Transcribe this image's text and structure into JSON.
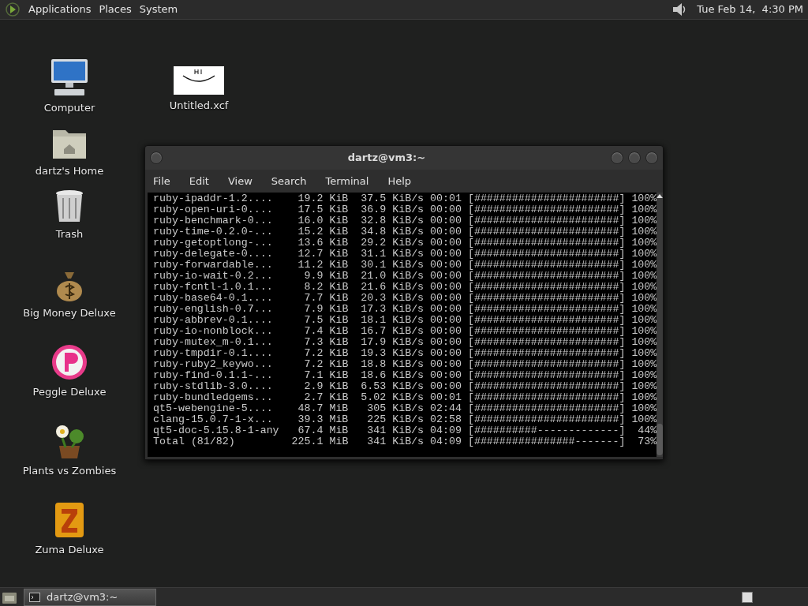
{
  "top_panel": {
    "menus": [
      "Applications",
      "Places",
      "System"
    ],
    "clock": "Tue Feb 14,  4:30 PM"
  },
  "desktop_icons": [
    {
      "label": "Computer",
      "kind": "computer"
    },
    {
      "label": "dartz's Home",
      "kind": "folder"
    },
    {
      "label": "Trash",
      "kind": "trash"
    },
    {
      "label": "Big Money Deluxe",
      "kind": "moneybag"
    },
    {
      "label": "Peggle Deluxe",
      "kind": "peggle"
    },
    {
      "label": "Plants vs Zombies",
      "kind": "plant"
    },
    {
      "label": "Zuma Deluxe",
      "kind": "zuma"
    },
    {
      "label": "Untitled.xcf",
      "kind": "image"
    }
  ],
  "terminal": {
    "title": "dartz@vm3:~",
    "menus": [
      "File",
      "Edit",
      "View",
      "Search",
      "Terminal",
      "Help"
    ],
    "rows": [
      {
        "name": "ruby-ipaddr-1.2....",
        "size": "19.2 KiB",
        "speed": "37.5 KiB/s",
        "time": "00:01",
        "bar": "[#######################]",
        "percent": "100%"
      },
      {
        "name": "ruby-open-uri-0....",
        "size": "17.5 KiB",
        "speed": "36.9 KiB/s",
        "time": "00:00",
        "bar": "[#######################]",
        "percent": "100%"
      },
      {
        "name": "ruby-benchmark-0...",
        "size": "16.0 KiB",
        "speed": "32.8 KiB/s",
        "time": "00:00",
        "bar": "[#######################]",
        "percent": "100%"
      },
      {
        "name": "ruby-time-0.2.0-...",
        "size": "15.2 KiB",
        "speed": "34.8 KiB/s",
        "time": "00:00",
        "bar": "[#######################]",
        "percent": "100%"
      },
      {
        "name": "ruby-getoptlong-...",
        "size": "13.6 KiB",
        "speed": "29.2 KiB/s",
        "time": "00:00",
        "bar": "[#######################]",
        "percent": "100%"
      },
      {
        "name": "ruby-delegate-0....",
        "size": "12.7 KiB",
        "speed": "31.1 KiB/s",
        "time": "00:00",
        "bar": "[#######################]",
        "percent": "100%"
      },
      {
        "name": "ruby-forwardable...",
        "size": "11.2 KiB",
        "speed": "30.1 KiB/s",
        "time": "00:00",
        "bar": "[#######################]",
        "percent": "100%"
      },
      {
        "name": "ruby-io-wait-0.2...",
        "size": "9.9 KiB",
        "speed": "21.0 KiB/s",
        "time": "00:00",
        "bar": "[#######################]",
        "percent": "100%"
      },
      {
        "name": "ruby-fcntl-1.0.1...",
        "size": "8.2 KiB",
        "speed": "21.6 KiB/s",
        "time": "00:00",
        "bar": "[#######################]",
        "percent": "100%"
      },
      {
        "name": "ruby-base64-0.1....",
        "size": "7.7 KiB",
        "speed": "20.3 KiB/s",
        "time": "00:00",
        "bar": "[#######################]",
        "percent": "100%"
      },
      {
        "name": "ruby-english-0.7...",
        "size": "7.9 KiB",
        "speed": "17.3 KiB/s",
        "time": "00:00",
        "bar": "[#######################]",
        "percent": "100%"
      },
      {
        "name": "ruby-abbrev-0.1....",
        "size": "7.5 KiB",
        "speed": "18.1 KiB/s",
        "time": "00:00",
        "bar": "[#######################]",
        "percent": "100%"
      },
      {
        "name": "ruby-io-nonblock...",
        "size": "7.4 KiB",
        "speed": "16.7 KiB/s",
        "time": "00:00",
        "bar": "[#######################]",
        "percent": "100%"
      },
      {
        "name": "ruby-mutex_m-0.1...",
        "size": "7.3 KiB",
        "speed": "17.9 KiB/s",
        "time": "00:00",
        "bar": "[#######################]",
        "percent": "100%"
      },
      {
        "name": "ruby-tmpdir-0.1....",
        "size": "7.2 KiB",
        "speed": "19.3 KiB/s",
        "time": "00:00",
        "bar": "[#######################]",
        "percent": "100%"
      },
      {
        "name": "ruby-ruby2_keywo...",
        "size": "7.2 KiB",
        "speed": "18.8 KiB/s",
        "time": "00:00",
        "bar": "[#######################]",
        "percent": "100%"
      },
      {
        "name": "ruby-find-0.1.1-...",
        "size": "7.1 KiB",
        "speed": "18.6 KiB/s",
        "time": "00:00",
        "bar": "[#######################]",
        "percent": "100%"
      },
      {
        "name": "ruby-stdlib-3.0....",
        "size": "2.9 KiB",
        "speed": "6.53 KiB/s",
        "time": "00:00",
        "bar": "[#######################]",
        "percent": "100%"
      },
      {
        "name": "ruby-bundledgems...",
        "size": "2.7 KiB",
        "speed": "5.02 KiB/s",
        "time": "00:01",
        "bar": "[#######################]",
        "percent": "100%"
      },
      {
        "name": "qt5-webengine-5....",
        "size": "48.7 MiB",
        "speed": "305 KiB/s",
        "time": "02:44",
        "bar": "[#######################]",
        "percent": "100%"
      },
      {
        "name": "clang-15.0.7-1-x...",
        "size": "39.3 MiB",
        "speed": "225 KiB/s",
        "time": "02:58",
        "bar": "[#######################]",
        "percent": "100%"
      },
      {
        "name": "qt5-doc-5.15.8-1-any",
        "size": "67.4 MiB",
        "speed": "341 KiB/s",
        "time": "04:09",
        "bar": "[##########-------------]",
        "percent": "44%"
      },
      {
        "name": "Total (81/82)",
        "size": "225.1 MiB",
        "speed": "341 KiB/s",
        "time": "04:09",
        "bar": "[################-------]",
        "percent": "73%"
      }
    ]
  },
  "taskbar": {
    "tasks": [
      {
        "label": "dartz@vm3:~",
        "selected": true
      }
    ]
  }
}
